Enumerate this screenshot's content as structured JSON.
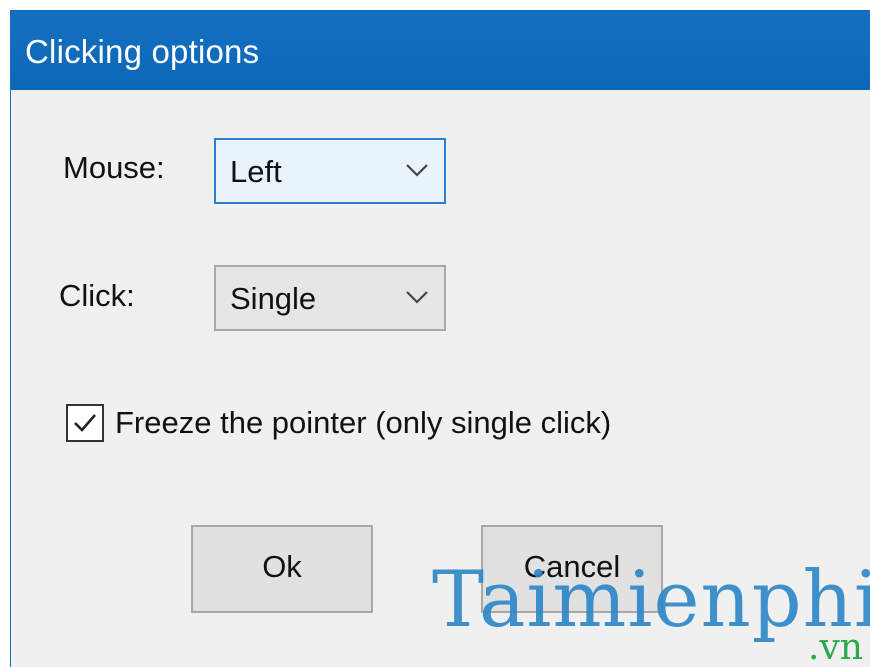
{
  "window": {
    "title": "Clicking options",
    "accent_color": "#0f6cbd"
  },
  "mouse": {
    "label": "Mouse:",
    "selected": "Left",
    "icon": "chevron-down-icon"
  },
  "click": {
    "label": "Click:",
    "selected": "Single",
    "icon": "chevron-down-icon"
  },
  "freeze": {
    "checked": true,
    "label": "Freeze the pointer (only single click)",
    "icon": "checkmark-icon"
  },
  "buttons": {
    "ok_label": "Ok",
    "cancel_label": "Cancel"
  },
  "watermark": {
    "text": "Taimienphi",
    "suffix": ".vn"
  }
}
